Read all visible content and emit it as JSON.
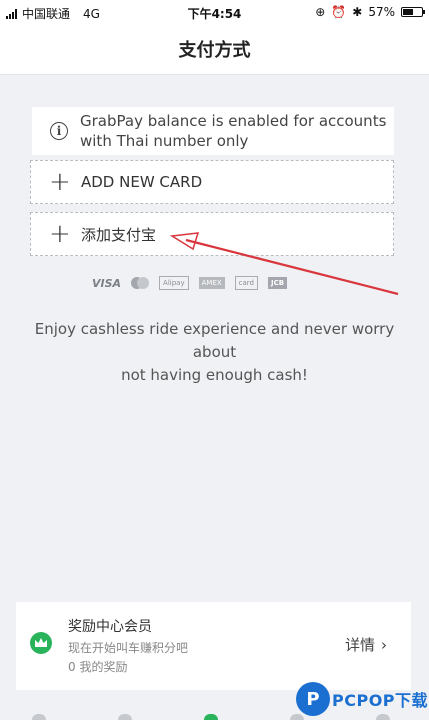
{
  "status_bar": {
    "carrier": "中国联通",
    "network": "4G",
    "time": "下午4:54",
    "battery": "57%",
    "battery_level": 0.57
  },
  "header": {
    "title": "支付方式"
  },
  "notice": {
    "icon": "info-icon",
    "line1": "GrabPay balance is enabled for accounts",
    "line2": "with Thai number only"
  },
  "payment_options": [
    {
      "icon": "plus-icon",
      "label": "ADD NEW CARD"
    },
    {
      "icon": "plus-icon",
      "label": "添加支付宝"
    }
  ],
  "card_logos": [
    "VISA",
    "mastercard",
    "Alipay",
    "AMEX",
    "card",
    "JCB"
  ],
  "promo": {
    "line1": "Enjoy cashless ride experience and never worry about",
    "line2": "not having enough cash!"
  },
  "annotation": {
    "color": "#d9363e"
  },
  "rewards": {
    "title": "奖励中心会员",
    "subtitle": "现在开始叫车赚积分吧",
    "points": "0 我的奖励",
    "details_label": "详情"
  },
  "watermark": {
    "text": "PCPOP下载"
  },
  "colors": {
    "accent_green": "#29b35a",
    "background": "#eff1f4",
    "watermark_blue": "#1b6fd1"
  }
}
